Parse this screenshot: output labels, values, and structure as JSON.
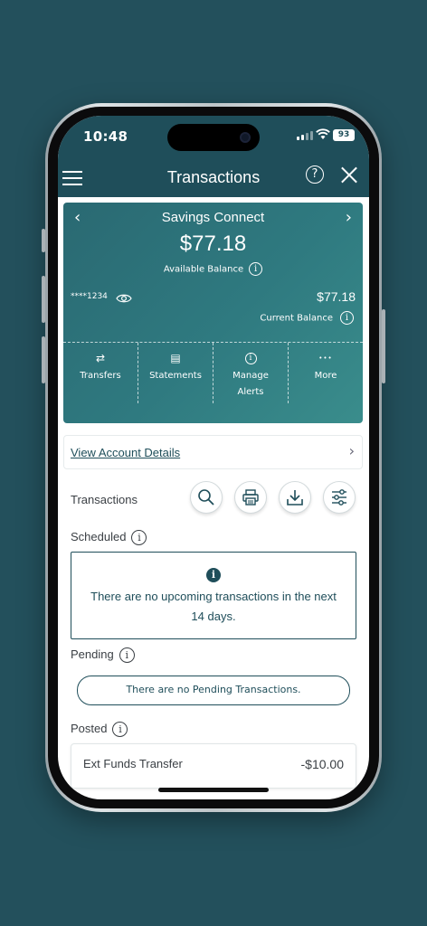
{
  "status_bar": {
    "time": "10:48",
    "battery": "93"
  },
  "nav": {
    "title": "Transactions",
    "help_glyph": "?"
  },
  "account_card": {
    "name": "Savings Connect",
    "available_amount": "$77.18",
    "available_label": "Available Balance",
    "masked_number": "****1234",
    "current_amount": "$77.18",
    "current_label": "Current Balance",
    "info_glyph": "i",
    "actions": [
      {
        "label": "Transfers",
        "icon": "transfer-arrows-icon",
        "glyph": "⇄"
      },
      {
        "label": "Statements",
        "icon": "document-icon",
        "glyph": "▤"
      },
      {
        "label": "Manage",
        "label2": "Alerts",
        "icon": "info-circle-icon",
        "glyph": "i"
      },
      {
        "label": "More",
        "icon": "ellipsis-icon",
        "glyph": "•••"
      }
    ]
  },
  "details_link": "View Account Details",
  "transactions": {
    "label": "Transactions",
    "tools": [
      "search-icon",
      "print-icon",
      "download-icon",
      "filter-sliders-icon"
    ]
  },
  "scheduled": {
    "label": "Scheduled",
    "message": "There are no upcoming transactions in the next 14 days."
  },
  "pending": {
    "label": "Pending",
    "message": "There are no Pending Transactions."
  },
  "posted": {
    "label": "Posted",
    "items": [
      {
        "name": "Ext Funds Transfer",
        "amount": "-$10.00"
      }
    ]
  },
  "colors": {
    "background": "#23505c",
    "brand": "#1f4e5a",
    "card": "#2f7a80"
  }
}
